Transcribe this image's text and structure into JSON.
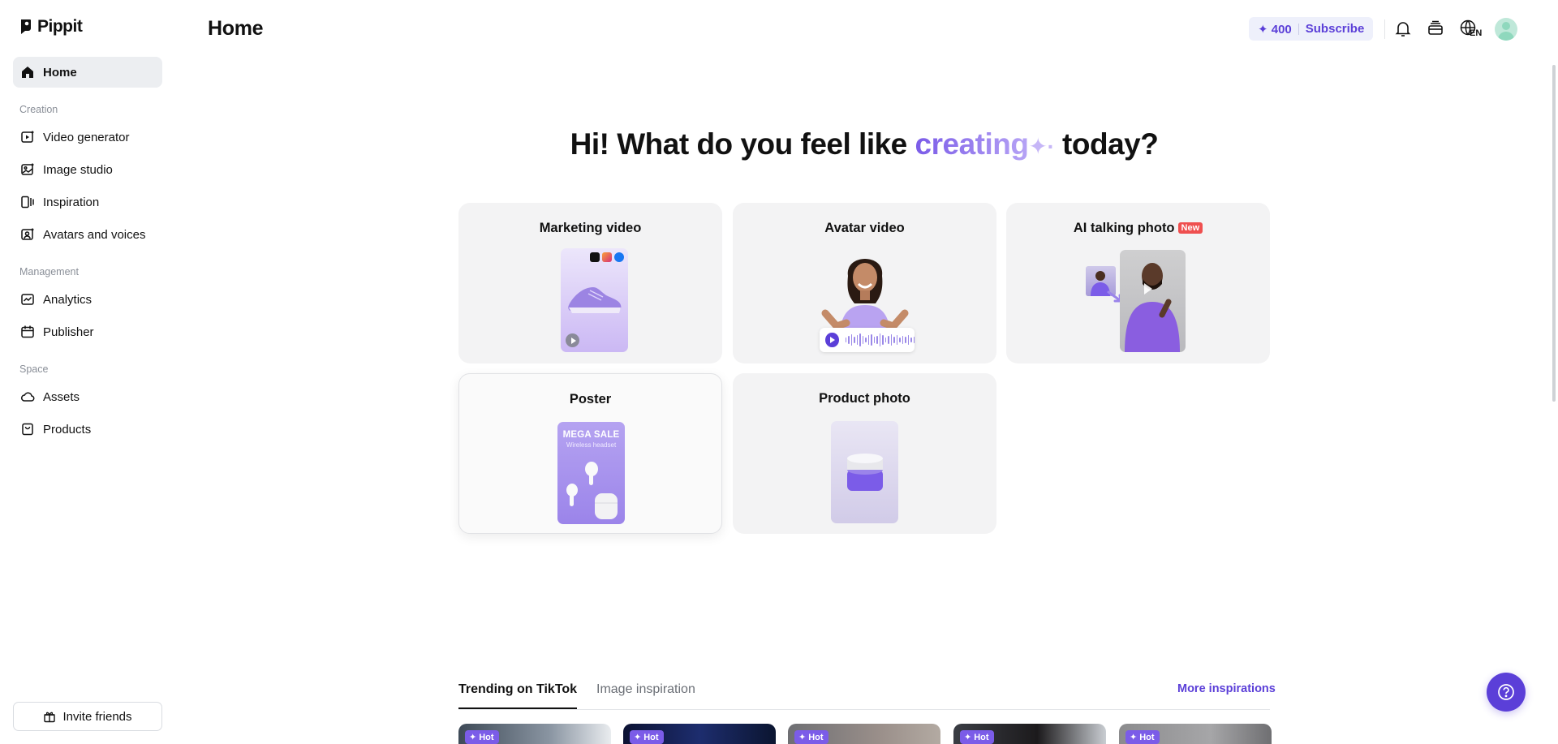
{
  "app": {
    "name": "Pippit"
  },
  "header": {
    "title": "Home",
    "credits": "✦ 400",
    "subscribe": "Subscribe",
    "language": "EN"
  },
  "sidebar": {
    "home": "Home",
    "sections": {
      "creation": "Creation",
      "management": "Management",
      "space": "Space"
    },
    "creation_items": [
      "Video generator",
      "Image studio",
      "Inspiration",
      "Avatars and voices"
    ],
    "management_items": [
      "Analytics",
      "Publisher"
    ],
    "space_items": [
      "Assets",
      "Products"
    ],
    "invite": "Invite friends"
  },
  "hero": {
    "prefix": "Hi! What do you feel like ",
    "highlight": "creating",
    "sparkle": "✦·",
    "suffix": " today?"
  },
  "cards": [
    {
      "title": "Marketing video"
    },
    {
      "title": "Avatar video"
    },
    {
      "title": "AI talking photo",
      "badge": "New"
    },
    {
      "title": "Poster",
      "poster_text": "MEGA SALE",
      "poster_sub": "Wireless headset"
    },
    {
      "title": "Product photo"
    }
  ],
  "inspiration": {
    "tabs": [
      "Trending on TikTok",
      "Image inspiration"
    ],
    "active_tab": "Trending on TikTok",
    "more": "More inspirations",
    "hot_label": "Hot",
    "tile_count": 5
  },
  "colors": {
    "accent": "#5b3fd8",
    "highlight_gradient_start": "#7b5ce8",
    "badge_red": "#ef4f4f",
    "card_bg": "#f3f3f4"
  },
  "icons": [
    "home-icon",
    "video-generator-icon",
    "image-studio-icon",
    "inspiration-icon",
    "avatars-voices-icon",
    "analytics-icon",
    "publisher-icon",
    "assets-icon",
    "products-icon",
    "gift-icon",
    "bell-icon",
    "stack-icon",
    "globe-icon",
    "help-icon"
  ]
}
